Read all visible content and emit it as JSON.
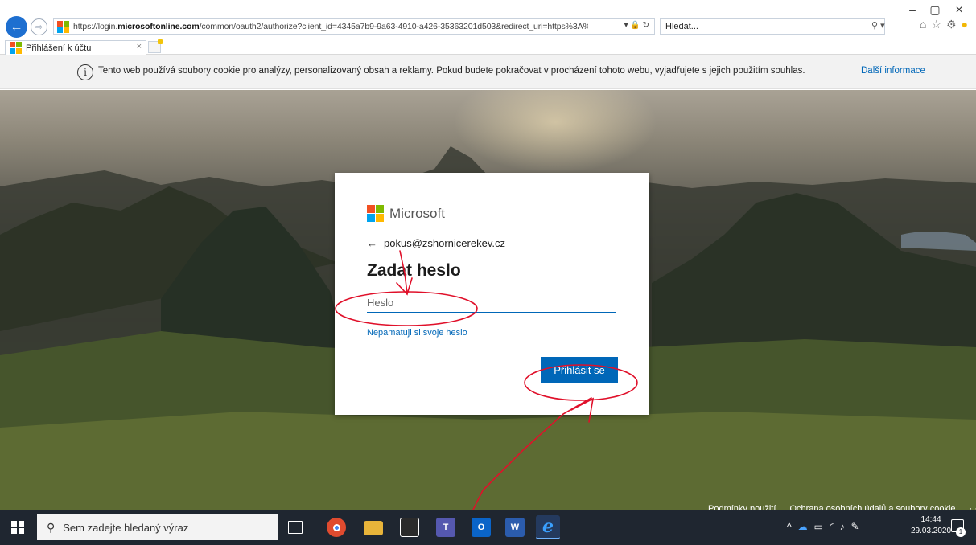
{
  "window": {
    "minimize": "–",
    "restore": "▢",
    "close": "×"
  },
  "address": {
    "url_prefix": "https://login.",
    "url_domain": "microsoftonline.com",
    "url_rest": "/common/oauth2/authorize?client_id=4345a7b9-9a63-4910-a426-35363201d503&redirect_uri=https%3A%2F%",
    "icons": "▾ 🔒 ↻",
    "search_placeholder": "Hledat..."
  },
  "tab": {
    "title": "Přihlášení k účtu",
    "close": "×"
  },
  "cookie": {
    "info_glyph": "i",
    "text": "Tento web používá soubory cookie pro analýzy, personalizovaný obsah a reklamy. Pokud budete pokračovat v procházení tohoto webu, vyjadřujete s jejich použitím souhlas.",
    "more": "Další informace"
  },
  "card": {
    "brand": "Microsoft",
    "back_glyph": "←",
    "email": "pokus@zshornicerekev.cz",
    "title": "Zadat heslo",
    "password_placeholder": "Heslo",
    "forgot": "Nepamatuji si svoje heslo",
    "signin": "Přihlásit se"
  },
  "footer": {
    "terms": "Podmínky použití",
    "privacy": "Ochrana osobních údajů a soubory cookie",
    "more": "· · ·"
  },
  "taskbar": {
    "search_placeholder": "Sem zadejte hledaný výraz",
    "time": "14:44",
    "date": "29.03.2020",
    "notifications": "1"
  },
  "colors": {
    "accent": "#0067b8",
    "taskbar": "#1f2630",
    "annotation": "#e0102a"
  }
}
